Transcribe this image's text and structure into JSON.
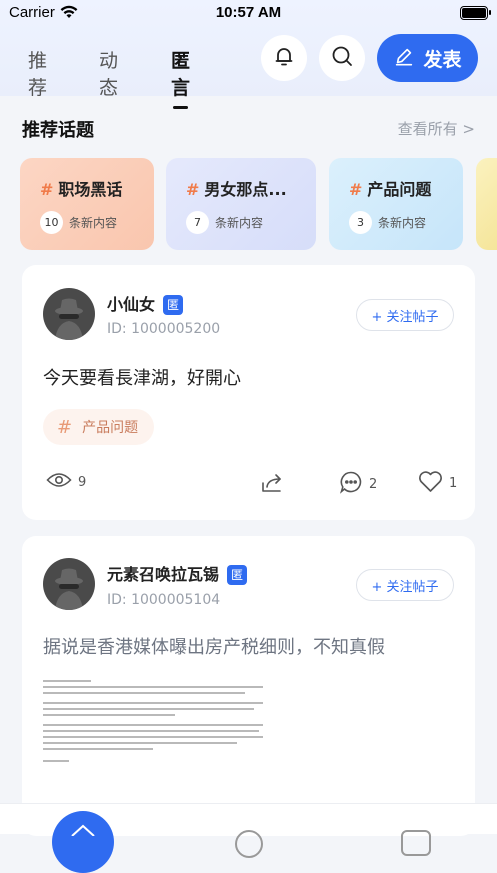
{
  "status_bar": {
    "carrier": "Carrier",
    "time": "10:57 AM"
  },
  "tabs": [
    {
      "label": "推荐",
      "active": false
    },
    {
      "label": "动态",
      "active": false
    },
    {
      "label": "匿言",
      "active": true
    }
  ],
  "header": {
    "bell_icon": "bell-icon",
    "search_icon": "search-icon",
    "post_label": "发表",
    "post_icon": "edit-icon"
  },
  "topics_section": {
    "title": "推荐话题",
    "see_all": "查看所有 >",
    "items": [
      {
        "name": "职场黑话",
        "count": "10",
        "suffix": "条新内容",
        "color": "#fbd3bf"
      },
      {
        "name": "男女那点...",
        "count": "7",
        "suffix": "条新内容",
        "color": "#dfe4fb"
      },
      {
        "name": "产品问题",
        "count": "3",
        "suffix": "条新内容",
        "color": "#d3ecfb"
      },
      {
        "name": "",
        "count": "",
        "suffix": "",
        "color": "#f8ecae"
      }
    ]
  },
  "posts": [
    {
      "username": "小仙女",
      "badge": "匿",
      "user_id": "ID: 1000005200",
      "follow_label": "+ 关注帖子",
      "content": "今天要看長津湖，好開心",
      "tag": "产品问题",
      "views": "9",
      "comments": "2",
      "likes": "1"
    },
    {
      "username": "元素召唤拉瓦锡",
      "badge": "匿",
      "user_id": "ID: 1000005104",
      "follow_label": "+ 关注帖子",
      "content": "据说是香港媒体曝出房产税细则，不知真假"
    }
  ],
  "colors": {
    "accent": "#2f6bf0",
    "tag_bg": "#fdf3ee",
    "tag_text": "#c97c5d"
  }
}
